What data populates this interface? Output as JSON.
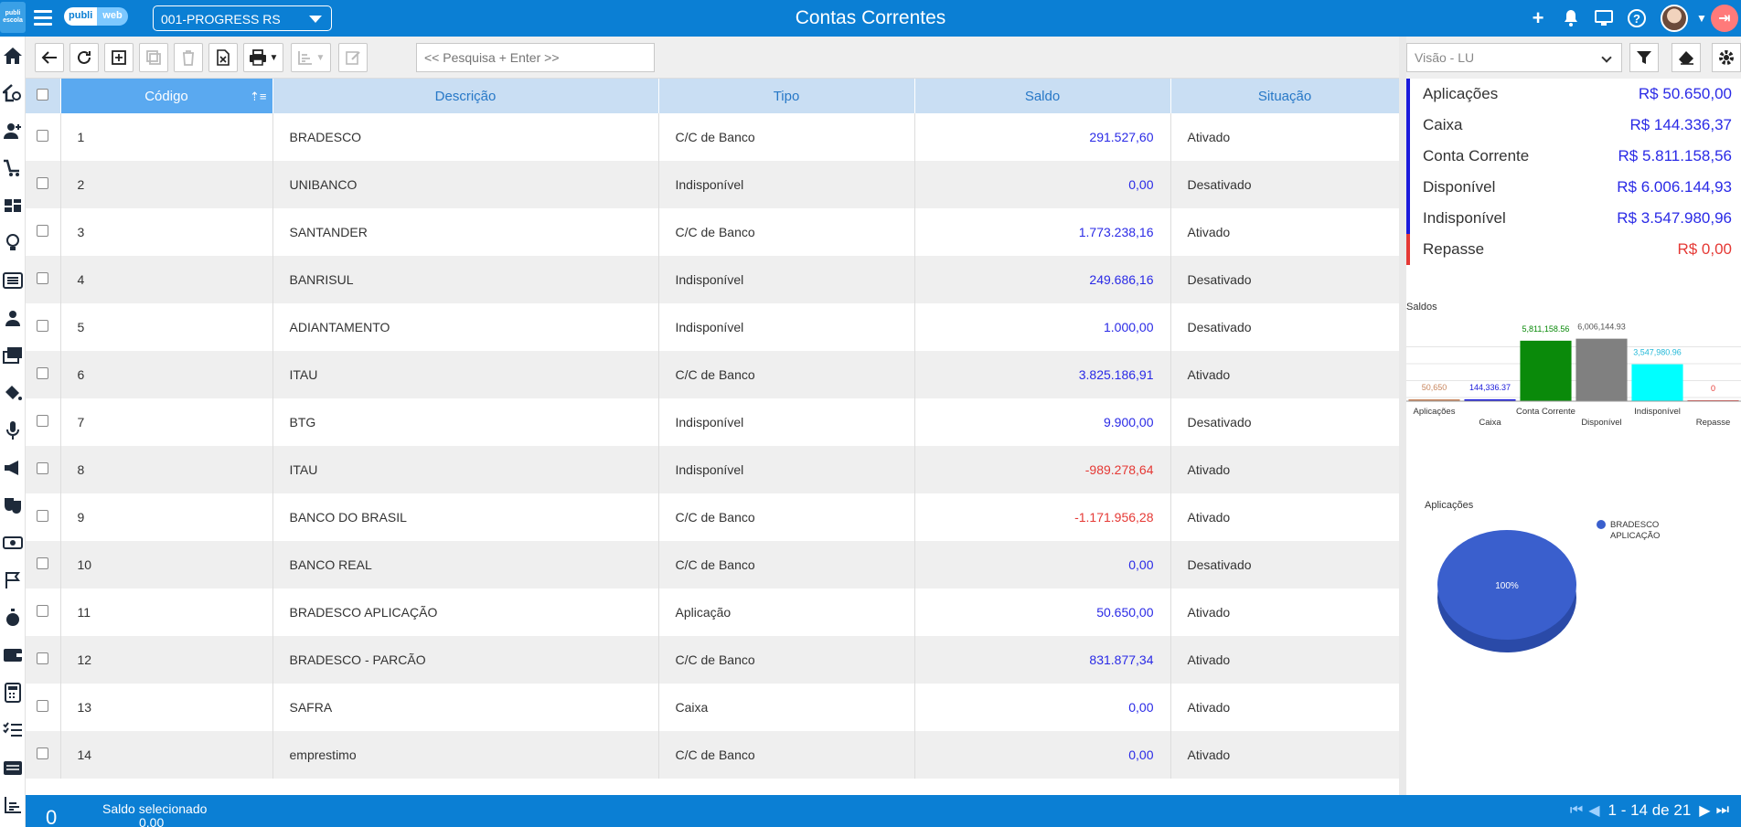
{
  "header": {
    "title": "Contas Correntes",
    "company": "001-PROGRESS RS",
    "logo_part1": "publi",
    "logo_part2": "web",
    "side_logo": "publi\nescola"
  },
  "toolbar": {
    "search_placeholder": "<< Pesquisa + Enter >>"
  },
  "table": {
    "columns": [
      "Código",
      "Descrição",
      "Tipo",
      "Saldo",
      "Situação"
    ],
    "rows": [
      {
        "codigo": "1",
        "descricao": "BRADESCO",
        "tipo": "C/C de Banco",
        "saldo": "291.527,60",
        "situacao": "Ativado",
        "neg": false
      },
      {
        "codigo": "2",
        "descricao": "UNIBANCO",
        "tipo": "Indisponível",
        "saldo": "0,00",
        "situacao": "Desativado",
        "neg": false
      },
      {
        "codigo": "3",
        "descricao": "SANTANDER",
        "tipo": "C/C de Banco",
        "saldo": "1.773.238,16",
        "situacao": "Ativado",
        "neg": false
      },
      {
        "codigo": "4",
        "descricao": "BANRISUL",
        "tipo": "Indisponível",
        "saldo": "249.686,16",
        "situacao": "Desativado",
        "neg": false
      },
      {
        "codigo": "5",
        "descricao": "ADIANTAMENTO",
        "tipo": "Indisponível",
        "saldo": "1.000,00",
        "situacao": "Desativado",
        "neg": false
      },
      {
        "codigo": "6",
        "descricao": "ITAU",
        "tipo": "C/C de Banco",
        "saldo": "3.825.186,91",
        "situacao": "Ativado",
        "neg": false
      },
      {
        "codigo": "7",
        "descricao": "BTG",
        "tipo": "Indisponível",
        "saldo": "9.900,00",
        "situacao": "Desativado",
        "neg": false
      },
      {
        "codigo": "8",
        "descricao": "ITAU",
        "tipo": "Indisponível",
        "saldo": "-989.278,64",
        "situacao": "Ativado",
        "neg": true
      },
      {
        "codigo": "9",
        "descricao": "BANCO DO BRASIL",
        "tipo": "C/C de Banco",
        "saldo": "-1.171.956,28",
        "situacao": "Ativado",
        "neg": true
      },
      {
        "codigo": "10",
        "descricao": "BANCO REAL",
        "tipo": "C/C de Banco",
        "saldo": "0,00",
        "situacao": "Desativado",
        "neg": false
      },
      {
        "codigo": "11",
        "descricao": "BRADESCO APLICAÇÃO",
        "tipo": "Aplicação",
        "saldo": "50.650,00",
        "situacao": "Ativado",
        "neg": false
      },
      {
        "codigo": "12",
        "descricao": "BRADESCO - PARCÃO",
        "tipo": "C/C de Banco",
        "saldo": "831.877,34",
        "situacao": "Ativado",
        "neg": false
      },
      {
        "codigo": "13",
        "descricao": "SAFRA",
        "tipo": "Caixa",
        "saldo": "0,00",
        "situacao": "Ativado",
        "neg": false
      },
      {
        "codigo": "14",
        "descricao": "emprestimo",
        "tipo": "C/C de Banco",
        "saldo": "0,00",
        "situacao": "Ativado",
        "neg": false
      }
    ]
  },
  "footer": {
    "selected_count": "0",
    "selected_label": "Saldo selecionado",
    "selected_value": "0,00",
    "pagination": "1 - 14 de 21"
  },
  "right_panel": {
    "view": "Visão - LU",
    "summary": [
      {
        "label": "Aplicações",
        "value": "R$ 50.650,00",
        "red": false
      },
      {
        "label": "Caixa",
        "value": "R$ 144.336,37",
        "red": false
      },
      {
        "label": "Conta Corrente",
        "value": "R$ 5.811.158,56",
        "red": false
      },
      {
        "label": "Disponível",
        "value": "R$ 6.006.144,93",
        "red": false
      },
      {
        "label": "Indisponível",
        "value": "R$ 3.547.980,96",
        "red": false
      },
      {
        "label": "Repasse",
        "value": "R$ 0,00",
        "red": true
      }
    ]
  },
  "chart_data": [
    {
      "type": "bar",
      "title": "Saldos",
      "categories": [
        "Aplicações",
        "Caixa",
        "Conta Corrente",
        "Disponível",
        "Indisponível",
        "Repasse"
      ],
      "values": [
        50650,
        144336.37,
        5811158.56,
        6006144.93,
        3547980.96,
        0
      ],
      "value_labels": [
        "50,650",
        "144,336.37",
        "5,811,158.56",
        "6,006,144.93",
        "3,547,980.96",
        "0"
      ],
      "colors": [
        "#c8865e",
        "#1a1adb",
        "#0a8a0a",
        "#808080",
        "#00ffff",
        "#e53935"
      ],
      "label_colors": [
        "#c8865e",
        "#1a1adb",
        "#0a8a0a",
        "#555555",
        "#22b8d8",
        "#e53935"
      ]
    },
    {
      "type": "pie",
      "title": "Aplicações",
      "slices": [
        {
          "label": "BRADESCO APLICAÇÃO",
          "value": 100,
          "display": "100%"
        }
      ],
      "legend_lines": [
        "BRADESCO",
        "APLICAÇÃO"
      ],
      "colors": [
        "#3a5fcd"
      ]
    }
  ]
}
